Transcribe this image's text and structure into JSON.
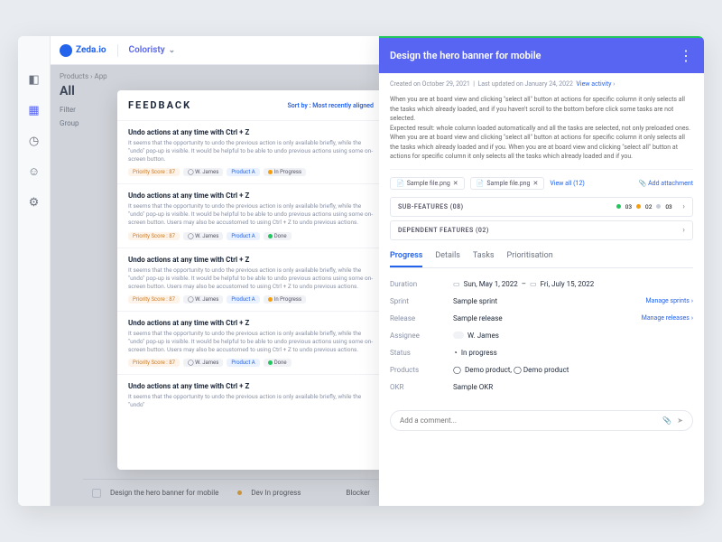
{
  "brand": "Zeda.io",
  "workspace": "Coloristy",
  "breadcrumb": "Products › App",
  "all_title": "All",
  "filters_label": "Filter",
  "group_label": "Group",
  "feedback": {
    "title": "FEEDBACK",
    "sort_prefix": "Sort by :",
    "sort_value": "Most recently aligned",
    "items": [
      {
        "title": "Undo actions at any time with Ctrl + Z",
        "desc": "It seems that the opportunity to undo the previous action is only available briefly, while the \"undo\" pop-up is visible. It would be helpful to be able to undo previous actions using some on-screen button.",
        "score": "Priority Score : 87",
        "user": "W. James",
        "product": "Product A",
        "status": "In Progress",
        "dot": "orange"
      },
      {
        "title": "Undo actions at any time with Ctrl + Z",
        "desc": "It seems that the opportunity to undo the previous action is only available briefly, while the \"undo\" pop-up is visible. It would be helpful to be able to undo previous actions using some on-screen button. Users may also be accustomed to using Ctrl + Z to undo previous actions.",
        "score": "Priority Score : 87",
        "user": "W. James",
        "product": "Product A",
        "status": "Done",
        "dot": "green"
      },
      {
        "title": "Undo actions at any time with Ctrl + Z",
        "desc": "It seems that the opportunity to undo the previous action is only available briefly, while the \"undo\" pop-up is visible. It would be helpful to be able to undo previous actions using some on-screen button. Users may also be accustomed to using Ctrl + Z to undo previous actions.",
        "score": "Priority Score : 87",
        "user": "W. James",
        "product": "Product A",
        "status": "In Progress",
        "dot": "orange"
      },
      {
        "title": "Undo actions at any time with Ctrl + Z",
        "desc": "It seems that the opportunity to undo the previous action is only available briefly, while the \"undo\" pop-up is visible. It would be helpful to be able to undo previous actions using some on-screen button. Users may also be accustomed to using Ctrl + Z to undo previous actions.",
        "score": "Priority Score : 87",
        "user": "W. James",
        "product": "Product A",
        "status": "Done",
        "dot": "green"
      },
      {
        "title": "Undo actions at any time with Ctrl + Z",
        "desc": "It seems that the opportunity to undo the previous action is only available briefly, while the \"undo\"",
        "score": "",
        "user": "",
        "product": "",
        "status": "",
        "dot": ""
      }
    ]
  },
  "bottom": {
    "title": "Design the hero banner for mobile",
    "status": "Dev In progress",
    "col": "Blocker"
  },
  "detail": {
    "title": "Design the hero banner for mobile",
    "created": "Created on October 29, 2021",
    "updated": "Last updated on January 24, 2022",
    "view_activity": "View activity",
    "description": "When you are at board view and clicking \"select all\" button at actions for specific column it only selects all the tasks which already loaded, and if you haven't scroll to the bottom before click some tasks are not selected.\nExpected result: whole column loaded automatically and all the tasks are selected, not only preloaded ones. When you are at board view and clicking \"select all\" button at actions for specific column it only selects all the tasks which already loaded and if you. When you are at board view and clicking \"select all\" button at actions for specific column it only selects all the tasks which already loaded and if you.",
    "attachments": [
      "Sample file.png",
      "Sample file.png"
    ],
    "view_all": "View all (12)",
    "add_attachment": "Add attachment",
    "subfeatures": {
      "label": "SUB-FEATURES  (08)",
      "stats": [
        {
          "dot": "green",
          "n": "03"
        },
        {
          "dot": "orange",
          "n": "02"
        },
        {
          "dot": "grey",
          "n": "03"
        }
      ]
    },
    "dependent": {
      "label": "DEPENDENT FEATURES  (02)"
    },
    "tabs": [
      "Progress",
      "Details",
      "Tasks",
      "Prioritisation"
    ],
    "active_tab": 0,
    "props": {
      "duration": {
        "label": "Duration",
        "start": "Sun, May 1, 2022",
        "end": "Fri, July 15, 2022"
      },
      "sprint": {
        "label": "Sprint",
        "value": "Sample sprint",
        "action": "Manage sprints"
      },
      "release": {
        "label": "Release",
        "value": "Sample release",
        "action": "Manage releases"
      },
      "assignee": {
        "label": "Assignee",
        "value": "W. James"
      },
      "status": {
        "label": "Status",
        "value": "In progress"
      },
      "products": {
        "label": "Products",
        "value": "Demo product,  ◯ Demo product"
      },
      "okr": {
        "label": "OKR",
        "value": "Sample OKR"
      }
    },
    "comment_placeholder": "Add a comment..."
  }
}
